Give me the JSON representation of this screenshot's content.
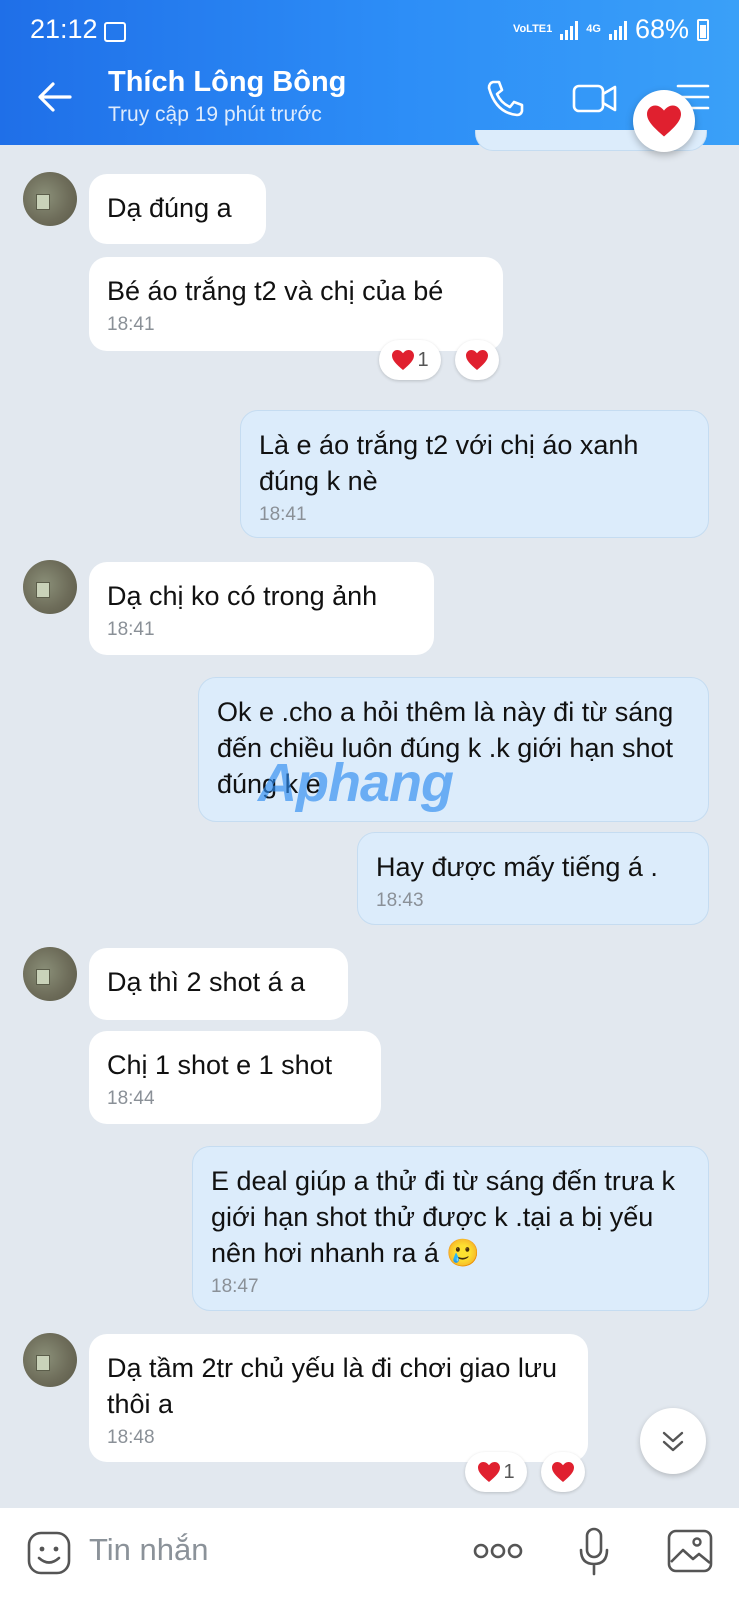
{
  "status": {
    "time": "21:12",
    "network_label": "VoLTE1",
    "network_4g": "4G",
    "battery": "68%"
  },
  "header": {
    "contact_name": "Thích Lông Bông",
    "last_seen": "Truy cập 19 phút trước"
  },
  "messages": [
    {
      "text": "Dạ đúng a",
      "time": ""
    },
    {
      "text": "Bé áo trắng t2 và chị của bé",
      "time": "18:41",
      "reaction_count": "1"
    },
    {
      "text": "Là e áo trắng t2 với chị áo xanh đúng k nè",
      "time": "18:41"
    },
    {
      "text": "Dạ chị ko có trong ảnh",
      "time": "18:41"
    },
    {
      "text": "Ok e .cho a hỏi thêm là này đi từ sáng đến chiều luôn đúng k .k giới hạn shot đúng k e",
      "time": ""
    },
    {
      "text": "Hay được mấy tiếng á .",
      "time": "18:43"
    },
    {
      "text": "Dạ thì 2 shot á a",
      "time": ""
    },
    {
      "text": "Chị 1 shot e 1 shot",
      "time": "18:44"
    },
    {
      "text": "E deal giúp a thử đi từ sáng đến trưa k giới hạn shot thử được k .tại a bị yếu nên hơi nhanh ra á 🥲",
      "time": "18:47"
    },
    {
      "text": "Dạ tầm 2tr chủ yếu là đi chơi giao lưu thôi a",
      "time": "18:48",
      "reaction_count": "1"
    }
  ],
  "watermark": "Aphang",
  "composer": {
    "placeholder": "Tin nhắn"
  },
  "colors": {
    "header_start": "#1f6fe8",
    "header_end": "#3aa0f8",
    "outgoing_bubble": "#dcecfb",
    "background": "#e2e8ef",
    "heart": "#e0202f"
  }
}
